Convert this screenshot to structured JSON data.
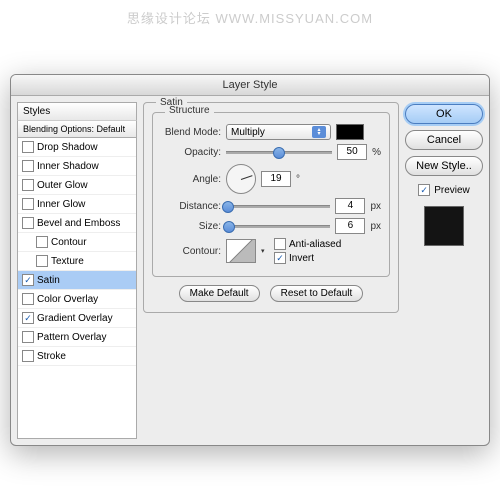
{
  "watermark": "思缘设计论坛  WWW.MISSYUAN.COM",
  "title": "Layer Style",
  "styles_header": "Styles",
  "blending_header": "Blending Options: Default",
  "style_items": [
    {
      "label": "Drop Shadow",
      "checked": false,
      "indent": false,
      "selected": false
    },
    {
      "label": "Inner Shadow",
      "checked": false,
      "indent": false,
      "selected": false
    },
    {
      "label": "Outer Glow",
      "checked": false,
      "indent": false,
      "selected": false
    },
    {
      "label": "Inner Glow",
      "checked": false,
      "indent": false,
      "selected": false
    },
    {
      "label": "Bevel and Emboss",
      "checked": false,
      "indent": false,
      "selected": false
    },
    {
      "label": "Contour",
      "checked": false,
      "indent": true,
      "selected": false
    },
    {
      "label": "Texture",
      "checked": false,
      "indent": true,
      "selected": false
    },
    {
      "label": "Satin",
      "checked": true,
      "indent": false,
      "selected": true
    },
    {
      "label": "Color Overlay",
      "checked": false,
      "indent": false,
      "selected": false
    },
    {
      "label": "Gradient Overlay",
      "checked": true,
      "indent": false,
      "selected": false
    },
    {
      "label": "Pattern Overlay",
      "checked": false,
      "indent": false,
      "selected": false
    },
    {
      "label": "Stroke",
      "checked": false,
      "indent": false,
      "selected": false
    }
  ],
  "panel": {
    "group_title": "Satin",
    "structure": "Structure",
    "blend_mode_label": "Blend Mode:",
    "blend_mode_value": "Multiply",
    "color": "#000000",
    "opacity_label": "Opacity:",
    "opacity_value": "50",
    "opacity_unit": "%",
    "angle_label": "Angle:",
    "angle_value": "19",
    "angle_unit": "°",
    "distance_label": "Distance:",
    "distance_value": "4",
    "distance_unit": "px",
    "size_label": "Size:",
    "size_value": "6",
    "size_unit": "px",
    "contour_label": "Contour:",
    "anti_aliased": "Anti-aliased",
    "invert": "Invert",
    "make_default": "Make Default",
    "reset_default": "Reset to Default"
  },
  "buttons": {
    "ok": "OK",
    "cancel": "Cancel",
    "new_style": "New Style..",
    "preview": "Preview"
  }
}
